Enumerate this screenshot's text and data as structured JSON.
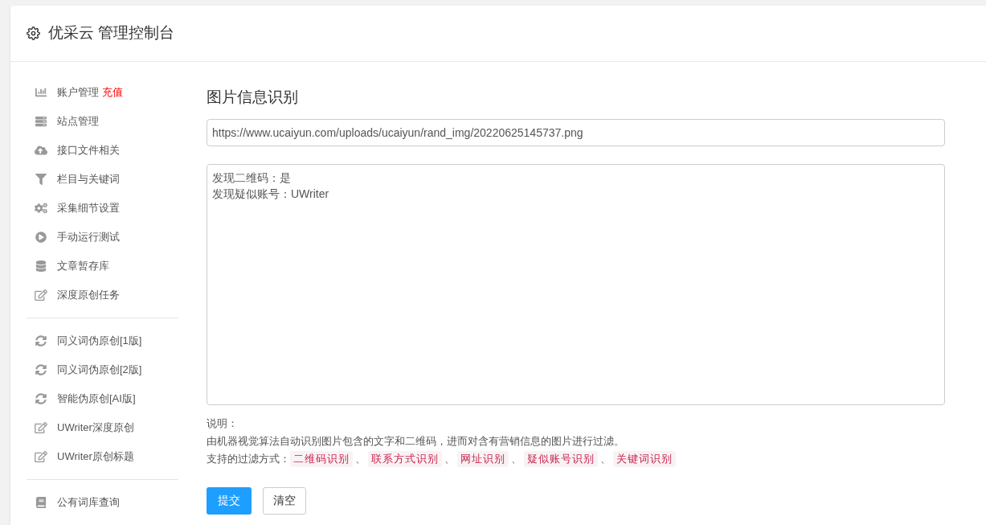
{
  "header": {
    "title": "优采云 管理控制台"
  },
  "sidebar": {
    "groups": [
      {
        "items": [
          {
            "label": "账户管理",
            "badge": "充值"
          },
          {
            "label": "站点管理"
          },
          {
            "label": "接口文件相关"
          },
          {
            "label": "栏目与关键词"
          },
          {
            "label": "采集细节设置"
          },
          {
            "label": "手动运行测试"
          },
          {
            "label": "文章暂存库"
          },
          {
            "label": "深度原创任务"
          }
        ]
      },
      {
        "items": [
          {
            "label": "同义词伪原创[1版]"
          },
          {
            "label": "同义词伪原创[2版]"
          },
          {
            "label": "智能伪原创[AI版]"
          },
          {
            "label": "UWriter深度原创"
          },
          {
            "label": "UWriter原创标题"
          }
        ]
      },
      {
        "items": [
          {
            "label": "公有词库查询"
          }
        ]
      }
    ]
  },
  "main": {
    "title": "图片信息识别",
    "url_field": {
      "value": "https://www.ucaiyun.com/uploads/ucaiyun/rand_img/20220625145737.png"
    },
    "result_box": {
      "lines": [
        "发现二维码：是",
        "发现疑似账号：UWriter"
      ]
    },
    "note": {
      "heading": "说明：",
      "description": "由机器视觉算法自动识别图片包含的文字和二维码，进而对含有营销信息的图片进行过滤。",
      "methods_label": "支持的过滤方式：",
      "separator": "、",
      "methods": [
        "二维码识别",
        "联系方式识别",
        "网址识别",
        "疑似账号识别",
        "关键词识别"
      ]
    },
    "buttons": [
      {
        "label": "提交",
        "kind": "primary"
      },
      {
        "label": "清空",
        "kind": "default"
      }
    ]
  }
}
